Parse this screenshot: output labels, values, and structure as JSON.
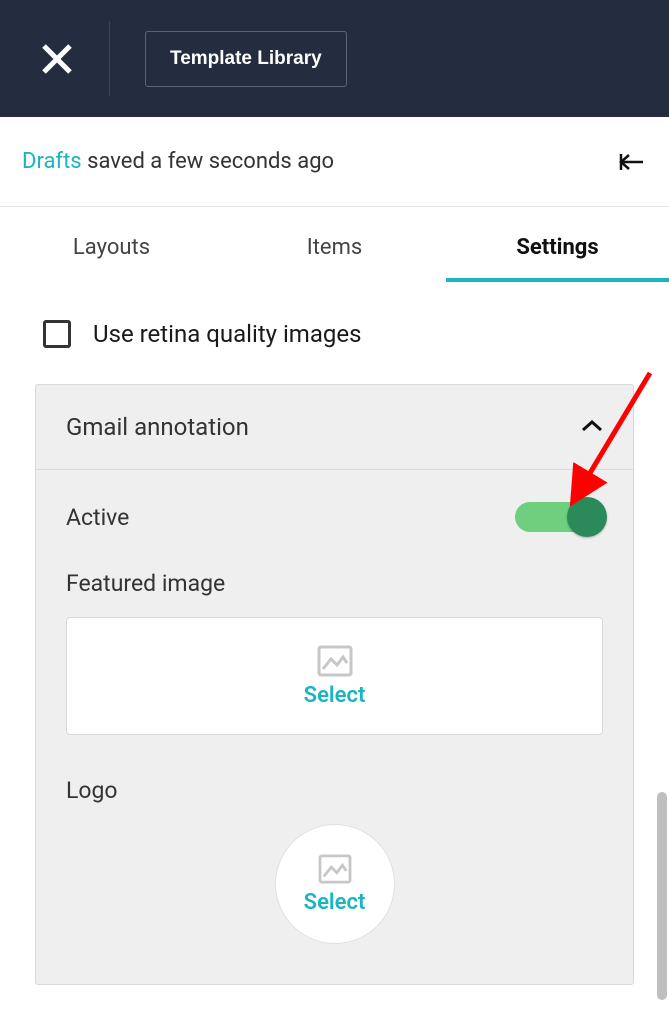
{
  "colors": {
    "accent": "#1bb5c1",
    "toggle_on": "#6fcf7e",
    "toggle_knob": "#2c8a5a"
  },
  "header": {
    "template_library_label": "Template Library"
  },
  "status": {
    "link_text": "Drafts",
    "suffix_text": " saved a few seconds ago"
  },
  "tabs": {
    "layouts": "Layouts",
    "items": "Items",
    "settings": "Settings"
  },
  "settings": {
    "retina_label": "Use retina quality images",
    "retina_checked": false,
    "panel": {
      "title": "Gmail annotation",
      "expanded": true,
      "active_label": "Active",
      "active_on": true,
      "featured_title": "Featured image",
      "featured_select": "Select",
      "logo_title": "Logo",
      "logo_select": "Select"
    }
  }
}
